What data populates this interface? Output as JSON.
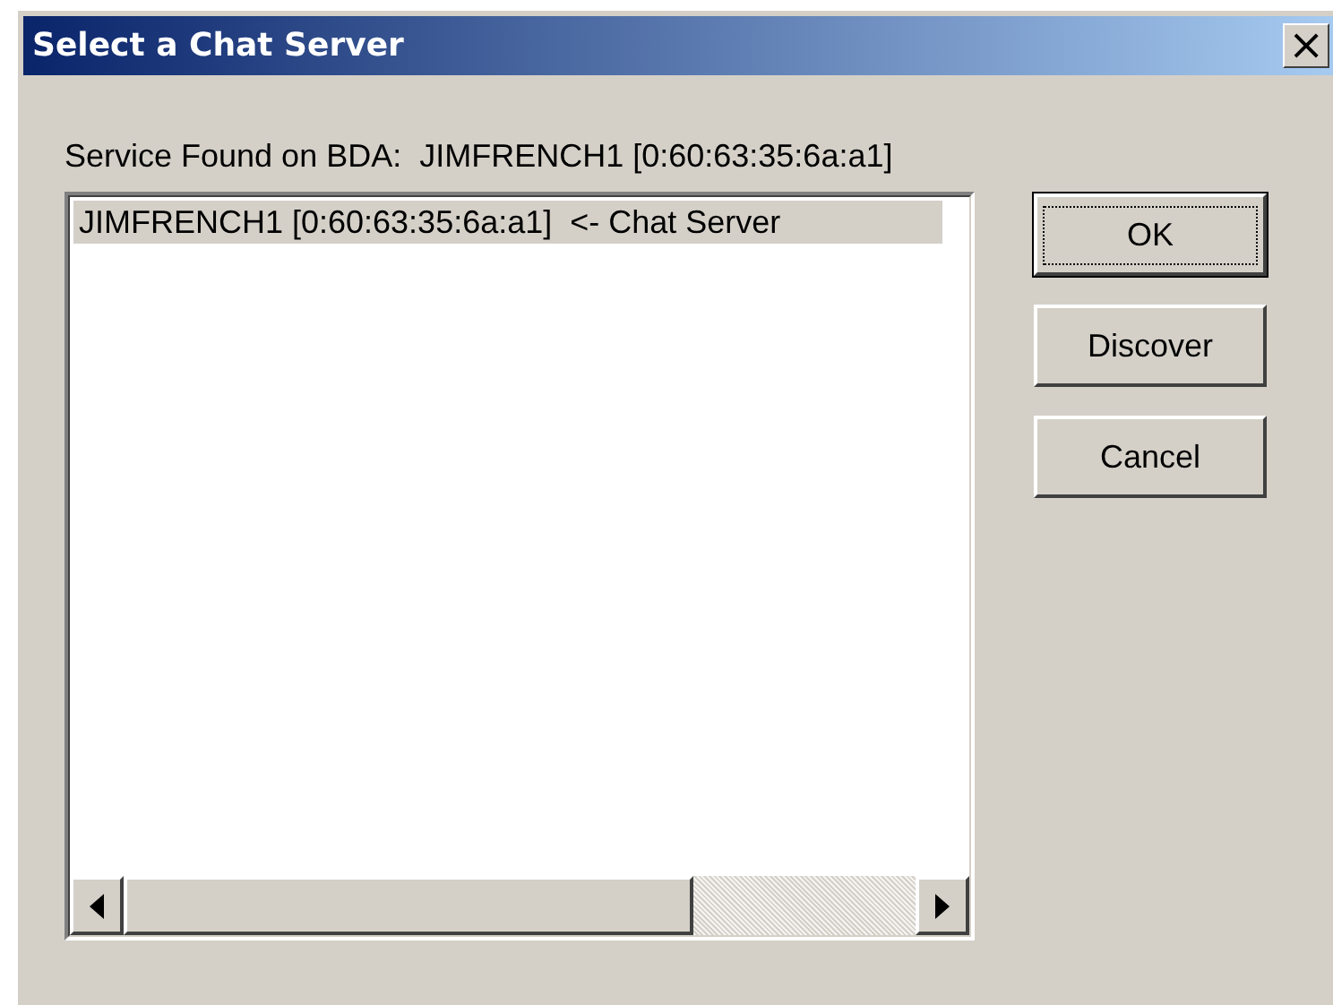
{
  "window": {
    "title": "Select a Chat Server",
    "close": "×"
  },
  "label": "Service Found on BDA:  JIMFRENCH1 [0:60:63:35:6a:a1]",
  "list": {
    "items": [
      {
        "text": "JIMFRENCH1 [0:60:63:35:6a:a1]  <- Chat Server",
        "selected": true
      }
    ]
  },
  "buttons": [
    {
      "label": "OK",
      "default": true
    },
    {
      "label": "Discover",
      "default": false
    },
    {
      "label": "Cancel",
      "default": false
    }
  ]
}
